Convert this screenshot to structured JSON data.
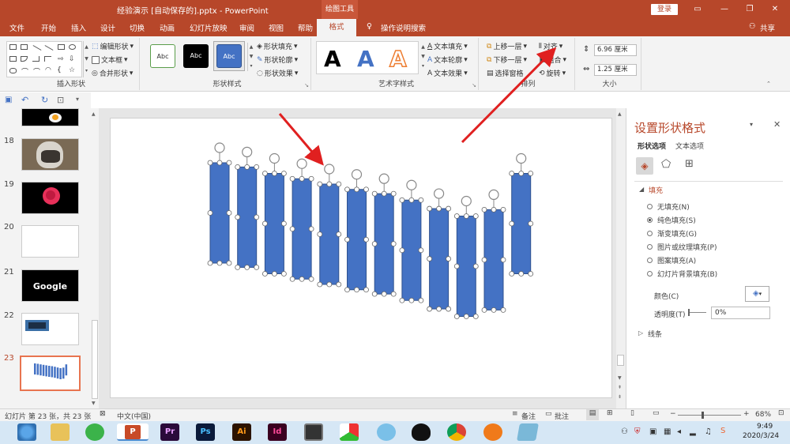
{
  "window": {
    "title": "经验演示 [自动保存的].pptx  -  PowerPoint",
    "tool_tab": "绘图工具",
    "login": "登录"
  },
  "ribbon_tabs": [
    "文件",
    "开始",
    "插入",
    "设计",
    "切换",
    "动画",
    "幻灯片放映",
    "审阅",
    "视图",
    "帮助",
    "格式"
  ],
  "tell_me": "操作说明搜索",
  "share": "共享",
  "ribbon": {
    "insert_shapes": {
      "label": "插入形状",
      "edit_shape": "编辑形状",
      "text_box": "文本框",
      "merge_shapes": "合并形状"
    },
    "shape_styles": {
      "label": "形状样式",
      "swatches": [
        "Abc",
        "Abc",
        "Abc"
      ],
      "fill": "形状填充",
      "outline": "形状轮廓",
      "effects": "形状效果"
    },
    "wordart": {
      "label": "艺术字样式",
      "letters": [
        "A",
        "A",
        "A"
      ],
      "text_fill": "文本填充",
      "text_outline": "文本轮廓",
      "text_effects": "文本效果"
    },
    "arrange": {
      "label": "排列",
      "bring_forward": "上移一层",
      "send_backward": "下移一层",
      "selection_pane": "选择窗格",
      "align": "对齐",
      "group": "组合",
      "rotate": "旋转"
    },
    "size": {
      "label": "大小",
      "height": "6.96 厘米",
      "width": "1.25 厘米"
    }
  },
  "slides": [
    {
      "num": "",
      "kind": "egg"
    },
    {
      "num": "18",
      "kind": "dog"
    },
    {
      "num": "19",
      "kind": "rose"
    },
    {
      "num": "20",
      "kind": "blank"
    },
    {
      "num": "21",
      "kind": "google",
      "text": "Google"
    },
    {
      "num": "22",
      "kind": "car"
    },
    {
      "num": "23",
      "kind": "bars"
    }
  ],
  "canvas": {
    "bar_tops_rel": [
      0.0,
      0.04,
      0.1,
      0.15,
      0.2,
      0.25,
      0.29,
      0.35,
      0.43,
      0.5,
      0.44,
      0.1
    ]
  },
  "panel": {
    "title": "设置形状格式",
    "tabs": [
      "形状选项",
      "文本选项"
    ],
    "fill_header": "填充",
    "fill_options": [
      "无填充(N)",
      "纯色填充(S)",
      "渐变填充(G)",
      "图片或纹理填充(P)",
      "图案填充(A)",
      "幻灯片背景填充(B)"
    ],
    "selected_fill": 1,
    "color_label": "颜色(C)",
    "transparency_label": "透明度(T)",
    "transparency_value": "0%",
    "line_header": "线条"
  },
  "status": {
    "slide_info": "幻灯片 第 23 张，共 23 张",
    "language": "中文(中国)",
    "notes": "备注",
    "comments": "批注",
    "zoom": "68%"
  },
  "taskbar": {
    "time": "9:49",
    "date": "2020/3/24",
    "app_labels": [
      "Pr",
      "Ps",
      "Ai",
      "Id"
    ]
  },
  "colors": {
    "accent": "#b7472a",
    "shape_fill": "#4472c4",
    "arrow": "#e02020"
  }
}
